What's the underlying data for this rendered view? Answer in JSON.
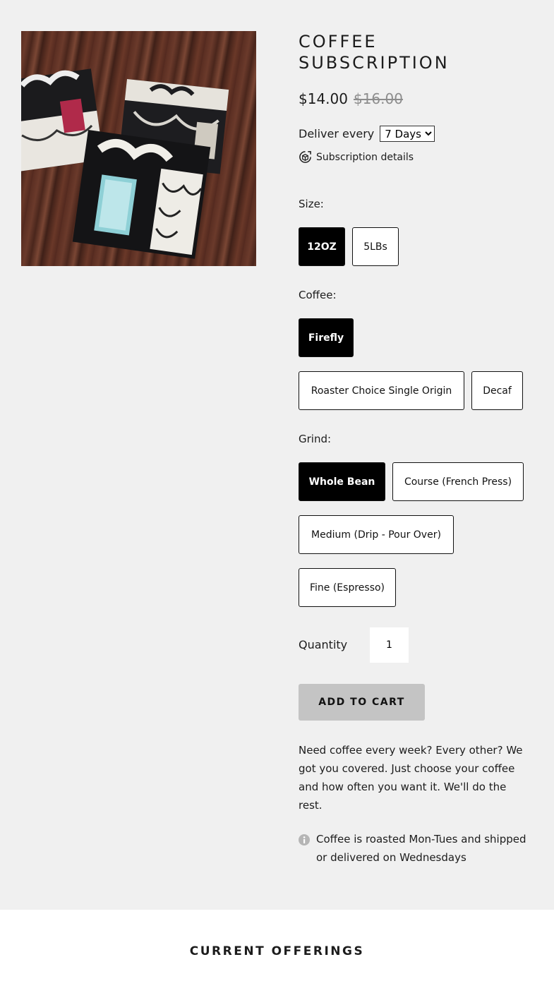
{
  "product": {
    "title": "COFFEE SUBSCRIPTION",
    "price": "$14.00",
    "compare_price": "$16.00",
    "image_alt": "product-image"
  },
  "subscription": {
    "deliver_label": "Deliver every",
    "frequency_selected": "7 Days",
    "details_link": "Subscription details"
  },
  "options": {
    "size": {
      "label": "Size:",
      "values": [
        "12OZ",
        "5LBs"
      ],
      "selected": "12OZ"
    },
    "coffee": {
      "label": "Coffee:",
      "values": [
        "Firefly",
        "Roaster Choice Single Origin",
        "Decaf"
      ],
      "selected": "Firefly"
    },
    "grind": {
      "label": "Grind:",
      "values": [
        "Whole Bean",
        "Course (French Press)",
        "Medium (Drip - Pour Over)",
        "Fine (Espresso)"
      ],
      "selected": "Whole Bean"
    }
  },
  "quantity": {
    "label": "Quantity",
    "value": "1"
  },
  "cart": {
    "add_label": "ADD TO CART"
  },
  "description": "Need coffee every week? Every other? We got you covered. Just choose your coffee and how often you want it. We'll do the rest.",
  "note": "Coffee is roasted Mon-Tues and shipped or delivered on Wednesdays",
  "offerings": {
    "title": "CURRENT OFFERINGS"
  },
  "colors": {
    "background": "#f0f0f0",
    "selected_option": "#000000",
    "button": "#c4c4c4",
    "compare_price": "#8d8d8d"
  },
  "icons": [
    "subscription-icon",
    "info-icon"
  ]
}
